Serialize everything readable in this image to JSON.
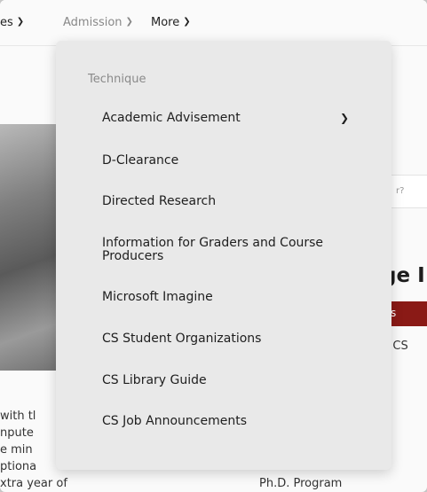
{
  "nav": {
    "items": [
      {
        "label": "es",
        "selected": false
      },
      {
        "label": "Admission",
        "selected": true
      },
      {
        "label": "More",
        "selected": false
      }
    ]
  },
  "background": {
    "search_placeholder": "r?",
    "heading": "ge I",
    "red_bar": "s",
    "subtext": "n CS",
    "paragraph": [
      "with tl",
      "npute",
      "e min",
      "ptiona",
      "xtra year of study"
    ],
    "phd": "Ph.D. Program"
  },
  "dropdown": {
    "heading": "Technique",
    "items": [
      {
        "label": "Academic Advisement",
        "has_submenu": true
      },
      {
        "label": "D-Clearance",
        "has_submenu": false
      },
      {
        "label": "Directed Research",
        "has_submenu": false
      },
      {
        "label": "Information for Graders and Course Producers",
        "has_submenu": false
      },
      {
        "label": "Microsoft Imagine",
        "has_submenu": false
      },
      {
        "label": "CS Student Organizations",
        "has_submenu": false
      },
      {
        "label": "CS Library Guide",
        "has_submenu": false
      },
      {
        "label": "CS Job Announcements",
        "has_submenu": false
      }
    ]
  },
  "colors": {
    "accent": "#8a1a16",
    "dropdown_bg": "#e9e9e9",
    "muted_text": "#8a8a8a"
  }
}
